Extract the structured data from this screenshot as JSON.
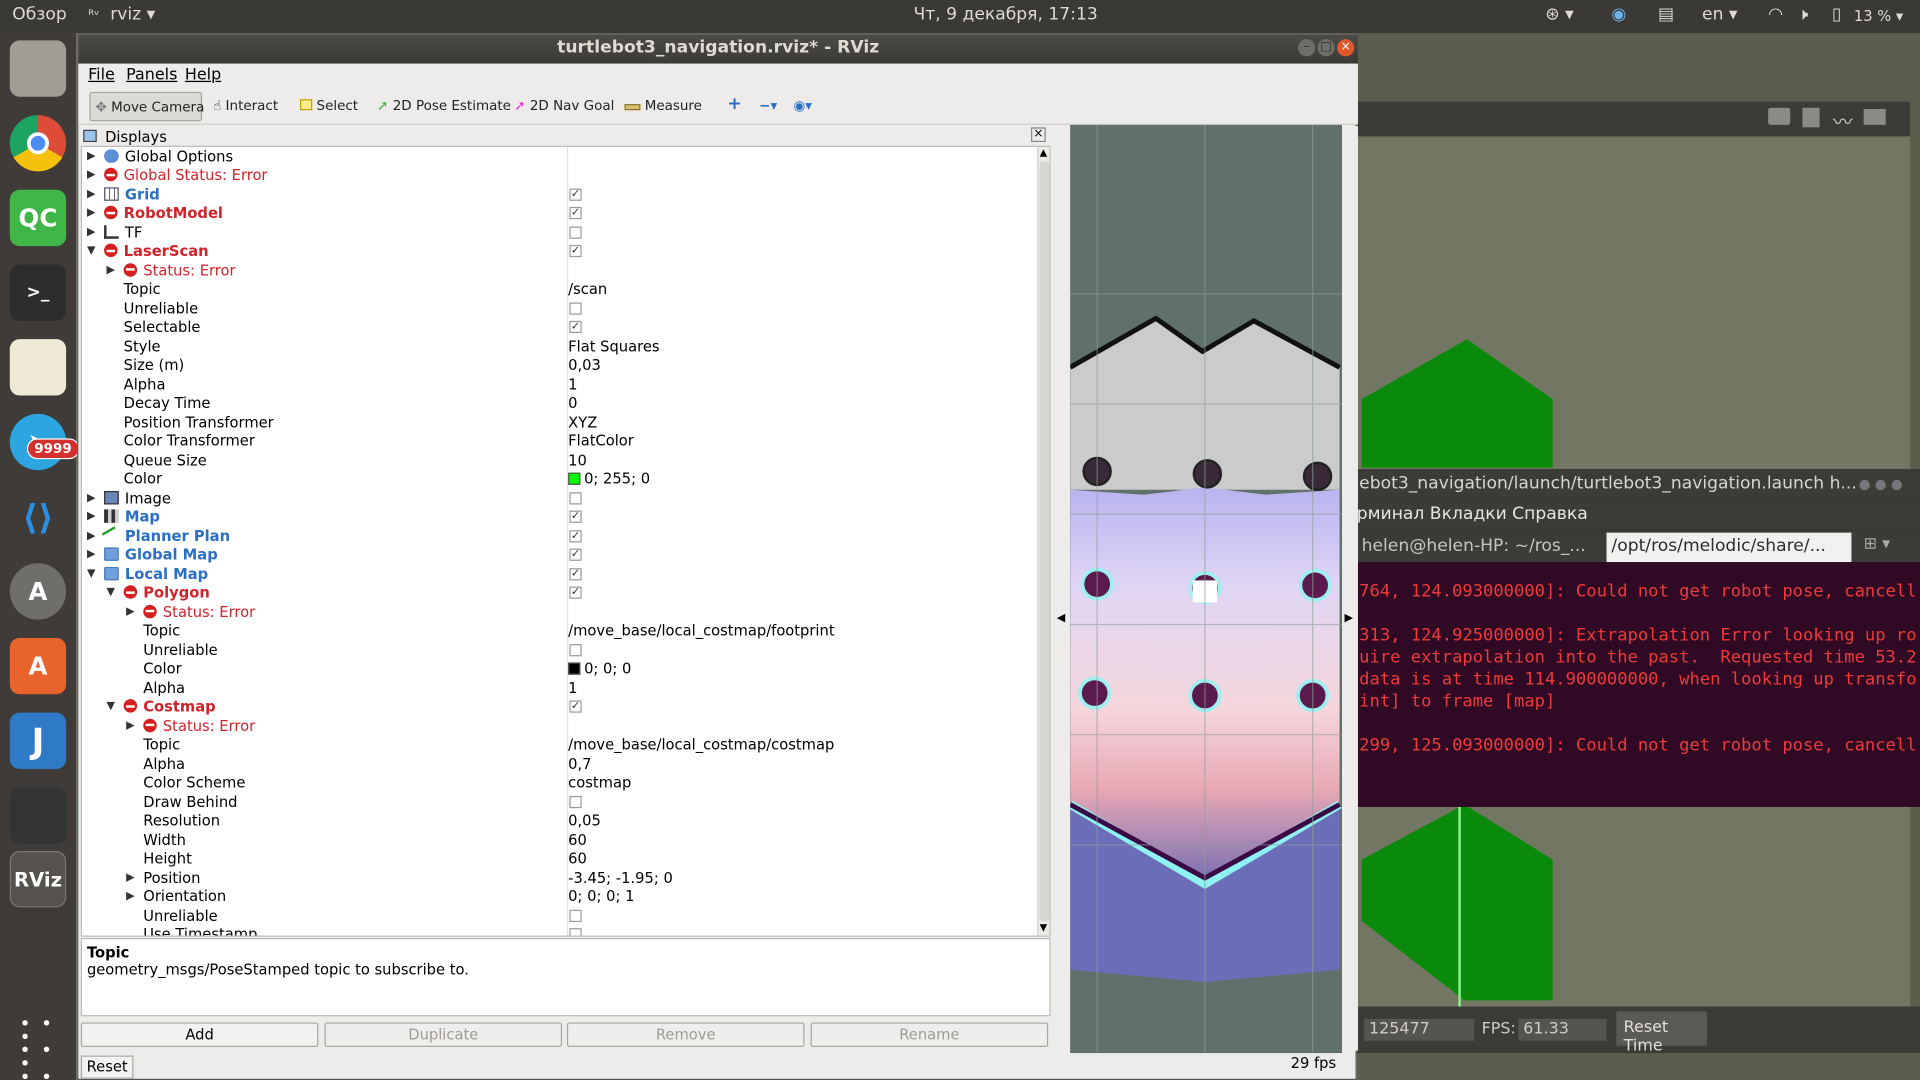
{
  "topbar": {
    "overview": "Обзор",
    "app_menu": "rviz ▾",
    "clock": "Чт, 9 декабря, 17:13",
    "lang": "en ▾",
    "battery": "13 % ▾"
  },
  "launcher": {
    "badge": "9999",
    "qc": "QC",
    "rviz": "RViz"
  },
  "window": {
    "title": "turtlebot3_navigation.rviz* - RViz"
  },
  "menu": {
    "file": "File",
    "panels": "Panels",
    "help": "Help"
  },
  "toolbar": {
    "move_camera": "Move Camera",
    "interact": "Interact",
    "select": "Select",
    "pose_estimate": "2D Pose Estimate",
    "nav_goal": "2D Nav Goal",
    "measure": "Measure"
  },
  "displays": {
    "title": "Displays",
    "rows": [
      {
        "label": "Global Options",
        "value": ""
      },
      {
        "label": "Global Status: Error",
        "value": ""
      },
      {
        "label": "Grid",
        "value": ""
      },
      {
        "label": "RobotModel",
        "value": ""
      },
      {
        "label": "TF",
        "value": ""
      },
      {
        "label": "LaserScan",
        "value": ""
      },
      {
        "label": "Status: Error",
        "value": ""
      },
      {
        "label": "Topic",
        "value": "/scan"
      },
      {
        "label": "Unreliable",
        "value": ""
      },
      {
        "label": "Selectable",
        "value": ""
      },
      {
        "label": "Style",
        "value": "Flat Squares"
      },
      {
        "label": "Size (m)",
        "value": "0,03"
      },
      {
        "label": "Alpha",
        "value": "1"
      },
      {
        "label": "Decay Time",
        "value": "0"
      },
      {
        "label": "Position Transformer",
        "value": "XYZ"
      },
      {
        "label": "Color Transformer",
        "value": "FlatColor"
      },
      {
        "label": "Queue Size",
        "value": "10"
      },
      {
        "label": "Color",
        "value": "0; 255; 0"
      },
      {
        "label": "Image",
        "value": ""
      },
      {
        "label": "Map",
        "value": ""
      },
      {
        "label": "Planner Plan",
        "value": ""
      },
      {
        "label": "Global Map",
        "value": ""
      },
      {
        "label": "Local Map",
        "value": ""
      },
      {
        "label": "Polygon",
        "value": ""
      },
      {
        "label": "Status: Error",
        "value": ""
      },
      {
        "label": "Topic",
        "value": "/move_base/local_costmap/footprint"
      },
      {
        "label": "Unreliable",
        "value": ""
      },
      {
        "label": "Color",
        "value": "0; 0; 0"
      },
      {
        "label": "Alpha",
        "value": "1"
      },
      {
        "label": "Costmap",
        "value": ""
      },
      {
        "label": "Status: Error",
        "value": ""
      },
      {
        "label": "Topic",
        "value": "/move_base/local_costmap/costmap"
      },
      {
        "label": "Alpha",
        "value": "0,7"
      },
      {
        "label": "Color Scheme",
        "value": "costmap"
      },
      {
        "label": "Draw Behind",
        "value": ""
      },
      {
        "label": "Resolution",
        "value": "0,05"
      },
      {
        "label": "Width",
        "value": "60"
      },
      {
        "label": "Height",
        "value": "60"
      },
      {
        "label": "Position",
        "value": "-3.45; -1.95; 0"
      },
      {
        "label": "Orientation",
        "value": "0; 0; 0; 1"
      },
      {
        "label": "Unreliable",
        "value": ""
      },
      {
        "label": "Use Timestamp",
        "value": ""
      }
    ]
  },
  "help": {
    "title": "Topic",
    "text": "geometry_msgs/PoseStamped topic to subscribe to."
  },
  "buttons": {
    "add": "Add",
    "duplicate": "Duplicate",
    "remove": "Remove",
    "rename": "Rename",
    "reset": "Reset"
  },
  "status": {
    "fps": "29 fps"
  },
  "terminal": {
    "title": "ebot3_navigation/launch/turtlebot3_navigation.launch h...",
    "menu": "рминал  Вкладки  Справка",
    "tab1": "helen@helen-HP: ~/ros_...",
    "tab2": "/opt/ros/melodic/share/...",
    "lines": [
      "764, 124.093000000]: Could not get robot pose, cancell",
      "313, 124.925000000]: Extrapolation Error looking up ro",
      "uire extrapolation into the past.  Requested time 53.2",
      "data is at time 114.900000000, when looking up transfo",
      "int] to frame [map]",
      "299, 125.093000000]: Could not get robot pose, cancell"
    ]
  },
  "bgstatus": {
    "time_val": "125477",
    "fps_label": "FPS:",
    "fps_val": "61.33",
    "reset_time": "Reset Time"
  },
  "colors": {
    "error": "#d2232a",
    "scan_color": "#00ff00",
    "terminal_bg": "#300a24"
  }
}
